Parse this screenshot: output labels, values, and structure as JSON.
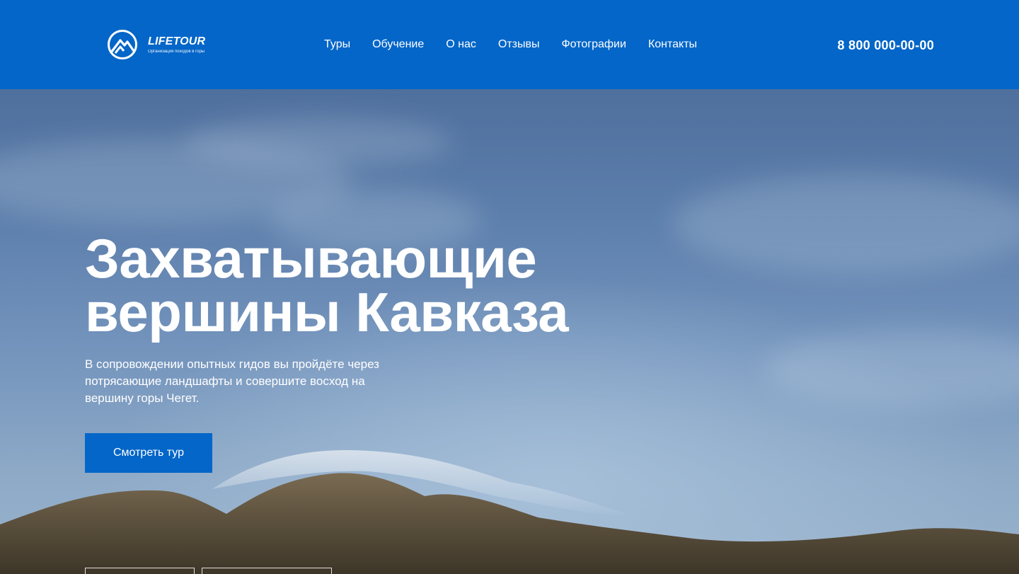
{
  "brand": {
    "name": "LIFETOUR",
    "tagline": "Организация походов в горы"
  },
  "nav": {
    "items": [
      {
        "label": "Туры"
      },
      {
        "label": "Обучение"
      },
      {
        "label": "О нас"
      },
      {
        "label": "Отзывы"
      },
      {
        "label": "Фотографии"
      },
      {
        "label": "Контакты"
      }
    ]
  },
  "header": {
    "phone": "8 800 000-00-00"
  },
  "hero": {
    "title_line1": "Захватывающие",
    "title_line2": "вершины Кавказа",
    "subtitle": "В сопровождении опытных гидов вы пройдёте через потрясающие ландшафты и совершите восход на вершину горы Чегет.",
    "cta_label": "Смотреть тур"
  },
  "colors": {
    "accent": "#0366c8",
    "text": "#ffffff"
  },
  "icons": {
    "logo": "mountain-logo-icon"
  }
}
